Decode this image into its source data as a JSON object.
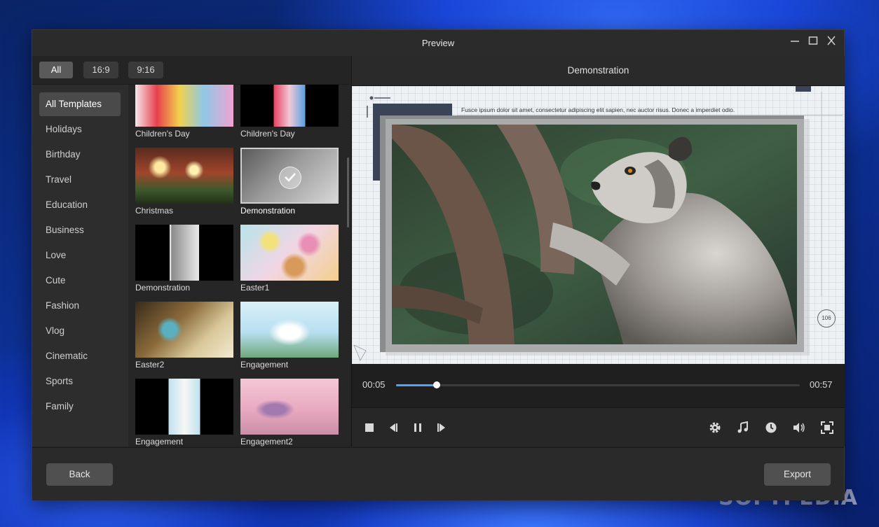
{
  "window": {
    "title": "Preview"
  },
  "aspect_filters": [
    {
      "label": "All",
      "selected": true
    },
    {
      "label": "16:9",
      "selected": false
    },
    {
      "label": "9:16",
      "selected": false
    }
  ],
  "categories": [
    "All Templates",
    "Holidays",
    "Birthday",
    "Travel",
    "Education",
    "Business",
    "Love",
    "Cute",
    "Fashion",
    "Vlog",
    "Cinematic",
    "Sports",
    "Family"
  ],
  "selected_category": "All Templates",
  "templates": [
    {
      "name": "Children's Day"
    },
    {
      "name": "Children's Day"
    },
    {
      "name": "Christmas"
    },
    {
      "name": "Demonstration",
      "selected": true
    },
    {
      "name": "Demonstration"
    },
    {
      "name": "Easter1"
    },
    {
      "name": "Easter2"
    },
    {
      "name": "Engagement"
    },
    {
      "name": "Engagement"
    },
    {
      "name": "Engagement2"
    },
    {
      "name": ""
    },
    {
      "name": ""
    }
  ],
  "preview": {
    "template_title": "Demonstration",
    "overlay_text": "Fusce ipsum dolor sit amet, consectetur adipiscing elit  sapien, nec auctor risus. Donec a imperdiet odio.",
    "overlay_badge": "106",
    "current_time": "00:05",
    "total_time": "00:57",
    "progress": 0.1
  },
  "playback_controls": [
    "stop-icon",
    "prev-frame-icon",
    "pause-icon",
    "next-frame-icon"
  ],
  "tool_controls": [
    "settings-icon",
    "music-icon",
    "clock-icon",
    "volume-icon",
    "fullscreen-icon"
  ],
  "footer": {
    "back_label": "Back",
    "export_label": "Export"
  },
  "watermark": "SOFTPEDIA",
  "colors": {
    "accent": "#4da3ff",
    "window_bg": "#232323"
  }
}
